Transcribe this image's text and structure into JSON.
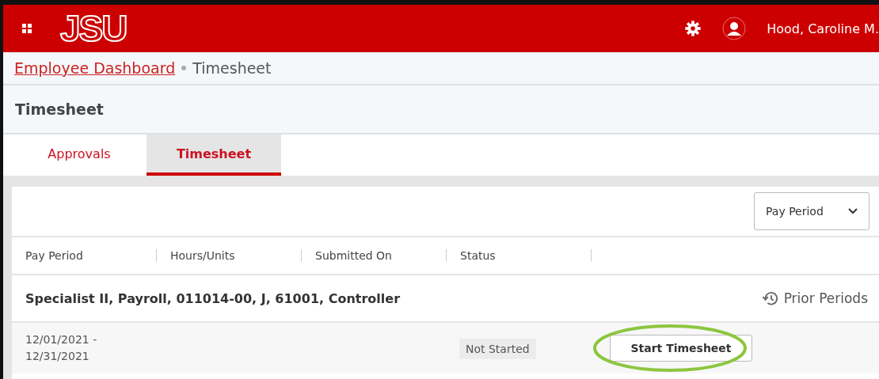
{
  "header": {
    "logo": "JSU",
    "user_name": "Hood, Caroline M."
  },
  "breadcrumb": {
    "link": "Employee Dashboard",
    "current": "Timesheet"
  },
  "page_title": "Timesheet",
  "tabs": [
    {
      "label": "Approvals",
      "selected": false
    },
    {
      "label": "Timesheet",
      "selected": true
    }
  ],
  "filter": {
    "value": "Pay Period"
  },
  "table": {
    "columns": [
      "Pay Period",
      "Hours/Units",
      "Submitted On",
      "Status"
    ],
    "group": {
      "title": "Specialist II, Payroll, 011014-00, J, 61001, Controller",
      "action": "Prior Periods"
    },
    "rows": [
      {
        "period_start": "12/01/2021 -",
        "period_end": "12/31/2021",
        "status": "Not Started",
        "action": "Start Timesheet",
        "highlighted": true
      }
    ]
  }
}
